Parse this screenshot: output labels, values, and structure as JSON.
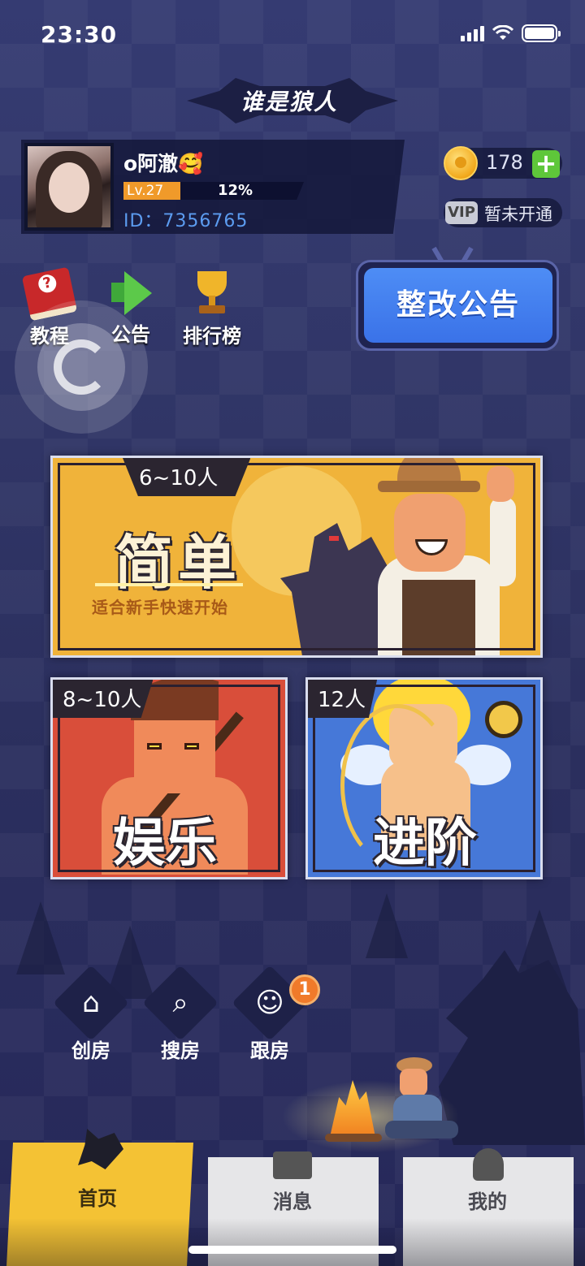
{
  "status_bar": {
    "time": "23:30"
  },
  "header": {
    "logo_text": "谁是狼人"
  },
  "profile": {
    "username": "o阿澈🥰",
    "level_label": "Lv.27",
    "level_progress_text": "12%",
    "level_progress": 0.12,
    "user_id": "ID：7356765"
  },
  "wallet": {
    "coins": "178",
    "add_label": "+",
    "vip_badge": "VIP",
    "vip_status": "暂未开通"
  },
  "shortcuts": [
    {
      "label": "教程",
      "icon": "tutorial-book-icon"
    },
    {
      "label": "公告",
      "icon": "megaphone-icon"
    },
    {
      "label": "排行榜",
      "icon": "trophy-icon"
    }
  ],
  "notice": {
    "label": "整改公告"
  },
  "modes": {
    "easy": {
      "players": "6~10人",
      "title": "简单",
      "subtitle": "适合新手快速开始"
    },
    "fun": {
      "players": "8~10人",
      "title": "娱乐"
    },
    "advanced": {
      "players": "12人",
      "title": "进阶"
    }
  },
  "room_actions": [
    {
      "label": "创房",
      "icon": "create-room-icon"
    },
    {
      "label": "搜房",
      "icon": "search-room-icon"
    },
    {
      "label": "跟房",
      "icon": "follow-room-icon",
      "badge": "1"
    }
  ],
  "nav": {
    "tabs": [
      {
        "label": "首页",
        "icon": "wolf-head-icon",
        "active": true
      },
      {
        "label": "消息",
        "icon": "message-icon"
      },
      {
        "label": "我的",
        "icon": "ghost-profile-icon"
      }
    ]
  },
  "colors": {
    "accent_yellow": "#f4c234",
    "notice_blue": "#4e8df5",
    "coin_add_green": "#5ec73a",
    "badge_orange": "#f07a2a"
  }
}
